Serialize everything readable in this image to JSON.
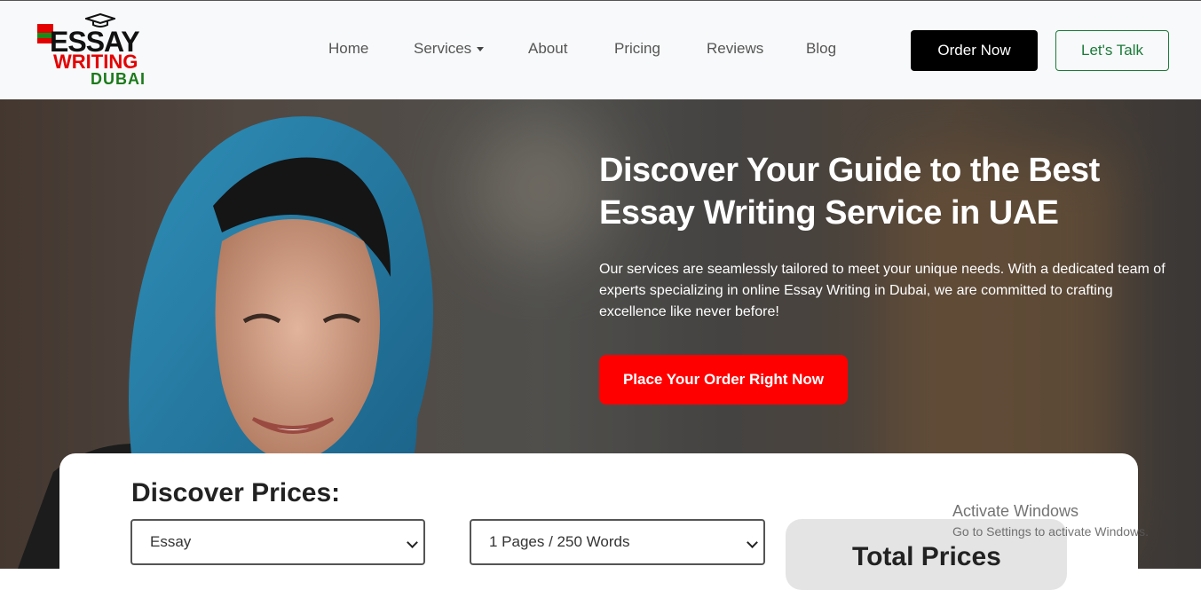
{
  "logo": {
    "line1": "ESSAY",
    "line2": "WRITING",
    "line3": "DUBAI"
  },
  "nav": {
    "home": "Home",
    "services": "Services",
    "about": "About",
    "pricing": "Pricing",
    "reviews": "Reviews",
    "blog": "Blog"
  },
  "buttons": {
    "order_now": "Order Now",
    "lets_talk": "Let's Talk",
    "place_order": "Place Your Order Right Now"
  },
  "hero": {
    "title": "Discover Your Guide to the Best Essay Writing Service in UAE",
    "description": "Our services are seamlessly tailored to meet your unique needs. With a dedicated team of experts specializing in online Essay Writing in Dubai, we are committed to crafting excellence like never before!"
  },
  "prices": {
    "title": "Discover Prices:",
    "type_select": "Essay",
    "pages_select": "1 Pages / 250 Words",
    "total_label": "Total Prices"
  },
  "watermark": {
    "line1": "Activate Windows",
    "line2": "Go to Settings to activate Windows."
  },
  "colors": {
    "accent_red": "#ff0000",
    "brand_green": "#1b7a3a",
    "black": "#000000"
  }
}
